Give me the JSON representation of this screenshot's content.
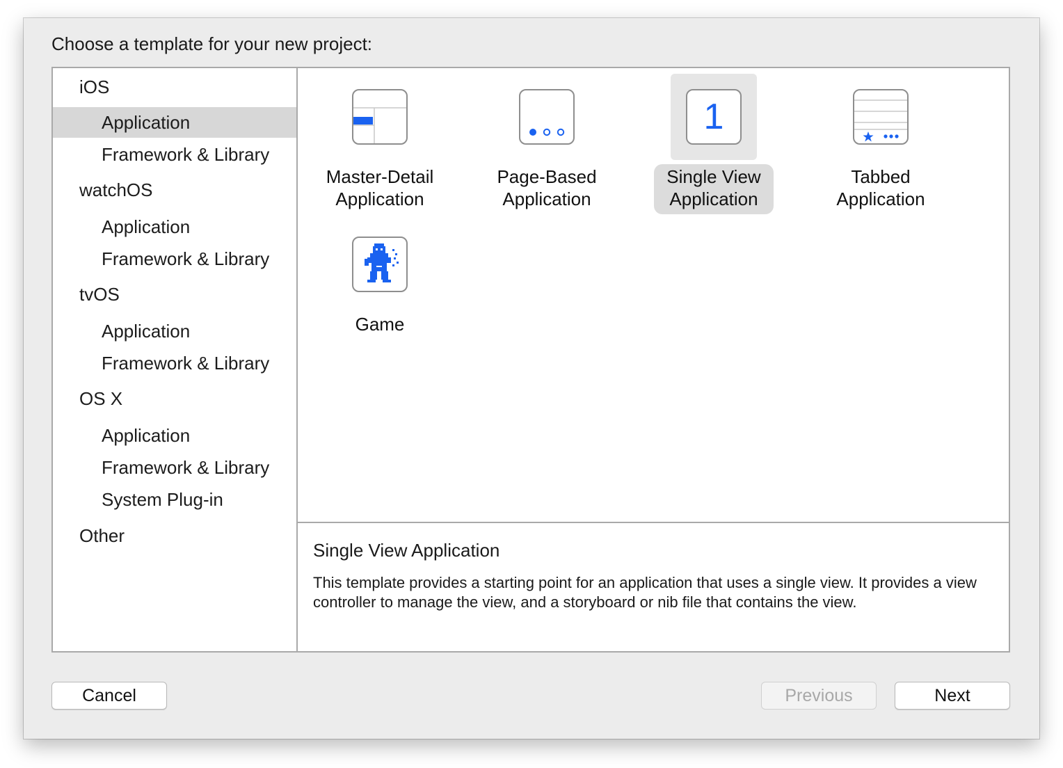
{
  "dialog": {
    "prompt": "Choose a template for your new project:"
  },
  "sidebar": {
    "groups": [
      {
        "label": "iOS",
        "items": [
          "Application",
          "Framework & Library"
        ]
      },
      {
        "label": "watchOS",
        "items": [
          "Application",
          "Framework & Library"
        ]
      },
      {
        "label": "tvOS",
        "items": [
          "Application",
          "Framework & Library"
        ]
      },
      {
        "label": "OS X",
        "items": [
          "Application",
          "Framework & Library",
          "System Plug-in"
        ]
      },
      {
        "label": "Other",
        "items": []
      }
    ],
    "selected": "iOS / Application"
  },
  "templates": [
    {
      "line1": "Master-Detail",
      "line2": "Application",
      "icon": "master-detail-icon"
    },
    {
      "line1": "Page-Based",
      "line2": "Application",
      "icon": "page-based-icon"
    },
    {
      "line1": "Single View",
      "line2": "Application",
      "icon": "single-view-icon",
      "icon_text": "1"
    },
    {
      "line1": "Tabbed",
      "line2": "Application",
      "icon": "tabbed-icon"
    },
    {
      "line1": "Game",
      "line2": "",
      "icon": "game-icon"
    }
  ],
  "selected_template": "Single View Application",
  "description": {
    "title": "Single View Application",
    "body": "This template provides a starting point for an application that uses a single view. It provides a view controller to manage the view, and a storyboard or nib file that contains the view."
  },
  "buttons": {
    "cancel": "Cancel",
    "previous": "Previous",
    "next": "Next"
  },
  "colors": {
    "accent": "#1a62f0",
    "selection_bg": "#d7d7d7"
  }
}
